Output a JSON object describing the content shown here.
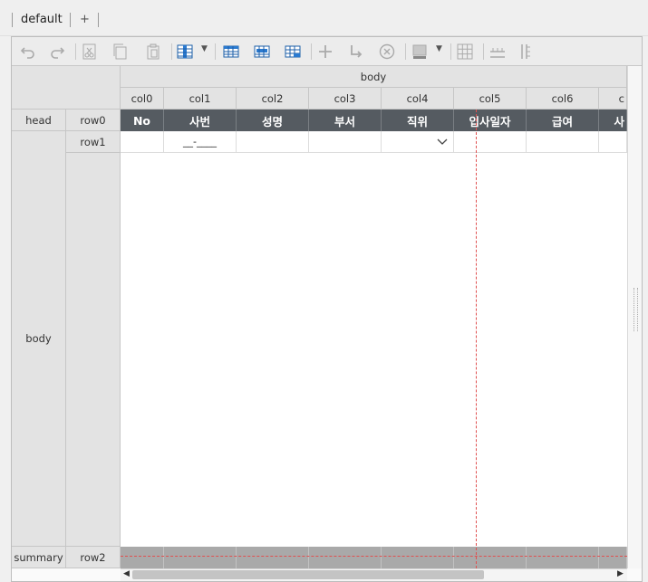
{
  "tabs": {
    "active": "default",
    "add": "+"
  },
  "toolbar": {
    "buttons": [
      "undo-icon",
      "redo-icon",
      "cut-icon",
      "copy-icon",
      "paste-icon",
      "column-insert-icon",
      "grid-blue-icon",
      "grid-header-icon",
      "grid-summary-icon",
      "add-icon",
      "arrow-enter-icon",
      "delete-circle-icon",
      "fill-color-icon",
      "grid-lines-icon",
      "split-horizontal-icon",
      "split-vertical-icon"
    ]
  },
  "grid": {
    "band_header": "body",
    "columns": [
      "col0",
      "col1",
      "col2",
      "col3",
      "col4",
      "col5",
      "col6",
      "c"
    ],
    "head_labels": [
      "No",
      "사번",
      "성명",
      "부서",
      "직위",
      "입사일자",
      "급여",
      "사"
    ],
    "row1_col1_mask": "__-____",
    "row_labels": {
      "row0": "row0",
      "row1": "row1",
      "row2": "row2"
    },
    "band_labels": {
      "head": "head",
      "body": "body",
      "summary": "summary"
    },
    "colors": {
      "head_bg": "#555b61",
      "summary_bg": "#a9a9a9",
      "guide": "#e05050"
    }
  }
}
